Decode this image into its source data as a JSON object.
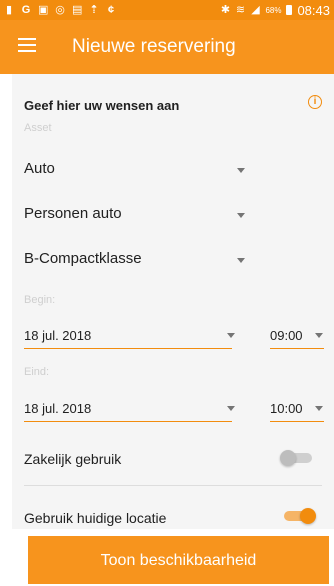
{
  "status_bar": {
    "battery_percent": "68%",
    "time": "08:43"
  },
  "app_bar": {
    "title": "Nieuwe reservering",
    "menu_icon": "hamburger-menu-icon"
  },
  "form": {
    "section_title": "Geef hier uw wensen aan",
    "info_icon": "info-icon",
    "asset": {
      "label": "Asset",
      "category": "Auto",
      "subcategory": "Personen auto",
      "class": "B-Compactklasse"
    },
    "begin": {
      "label": "Begin:",
      "date": "18 jul. 2018",
      "time": "09:00"
    },
    "end": {
      "label": "Eind:",
      "date": "18 jul. 2018",
      "time": "10:00"
    },
    "business_use": {
      "label": "Zakelijk gebruik",
      "enabled": false
    },
    "current_location": {
      "label": "Gebruik huidige locatie",
      "enabled": true
    }
  },
  "cta": {
    "label": "Toon beschikbaarheid"
  },
  "colors": {
    "accent": "#f7941d",
    "status_bar": "#f28c0e",
    "surface": "#f5f5f5"
  }
}
